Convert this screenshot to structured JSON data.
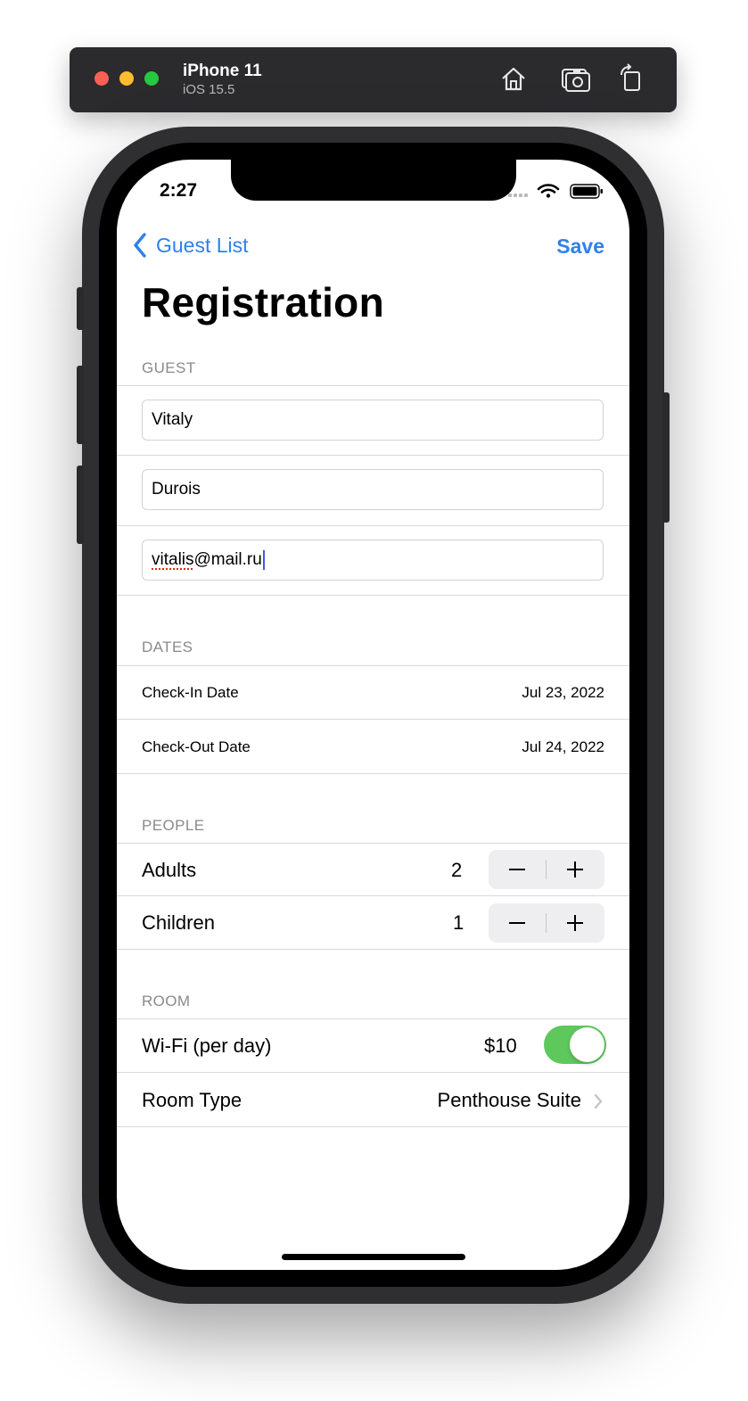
{
  "simulator": {
    "device_name": "iPhone 11",
    "os_version": "iOS 15.5",
    "toolbar_icons": [
      "home-icon",
      "screenshot-icon",
      "rotate-icon"
    ]
  },
  "status_bar": {
    "time": "2:27",
    "icons": [
      "signal-icon",
      "wifi-icon",
      "battery-icon"
    ]
  },
  "nav": {
    "back_label": "Guest List",
    "save_label": "Save",
    "title": "Registration",
    "accent_color": "#2f80ed"
  },
  "guest": {
    "header": "GUEST",
    "first_name": "Vitaly",
    "last_name": "Durois",
    "email_user": "vitalis",
    "email_domain": "@mail.ru"
  },
  "dates": {
    "header": "DATES",
    "check_in_label": "Check-In Date",
    "check_in_value": "Jul 23, 2022",
    "check_out_label": "Check-Out Date",
    "check_out_value": "Jul 24, 2022"
  },
  "people": {
    "header": "PEOPLE",
    "adults_label": "Adults",
    "adults_value": "2",
    "children_label": "Children",
    "children_value": "1"
  },
  "room": {
    "header": "ROOM",
    "wifi_label": "Wi-Fi (per day)",
    "wifi_price": "$10",
    "wifi_enabled": true,
    "toggle_color": "#5fc85d",
    "room_type_label": "Room Type",
    "room_type_value": "Penthouse Suite"
  }
}
